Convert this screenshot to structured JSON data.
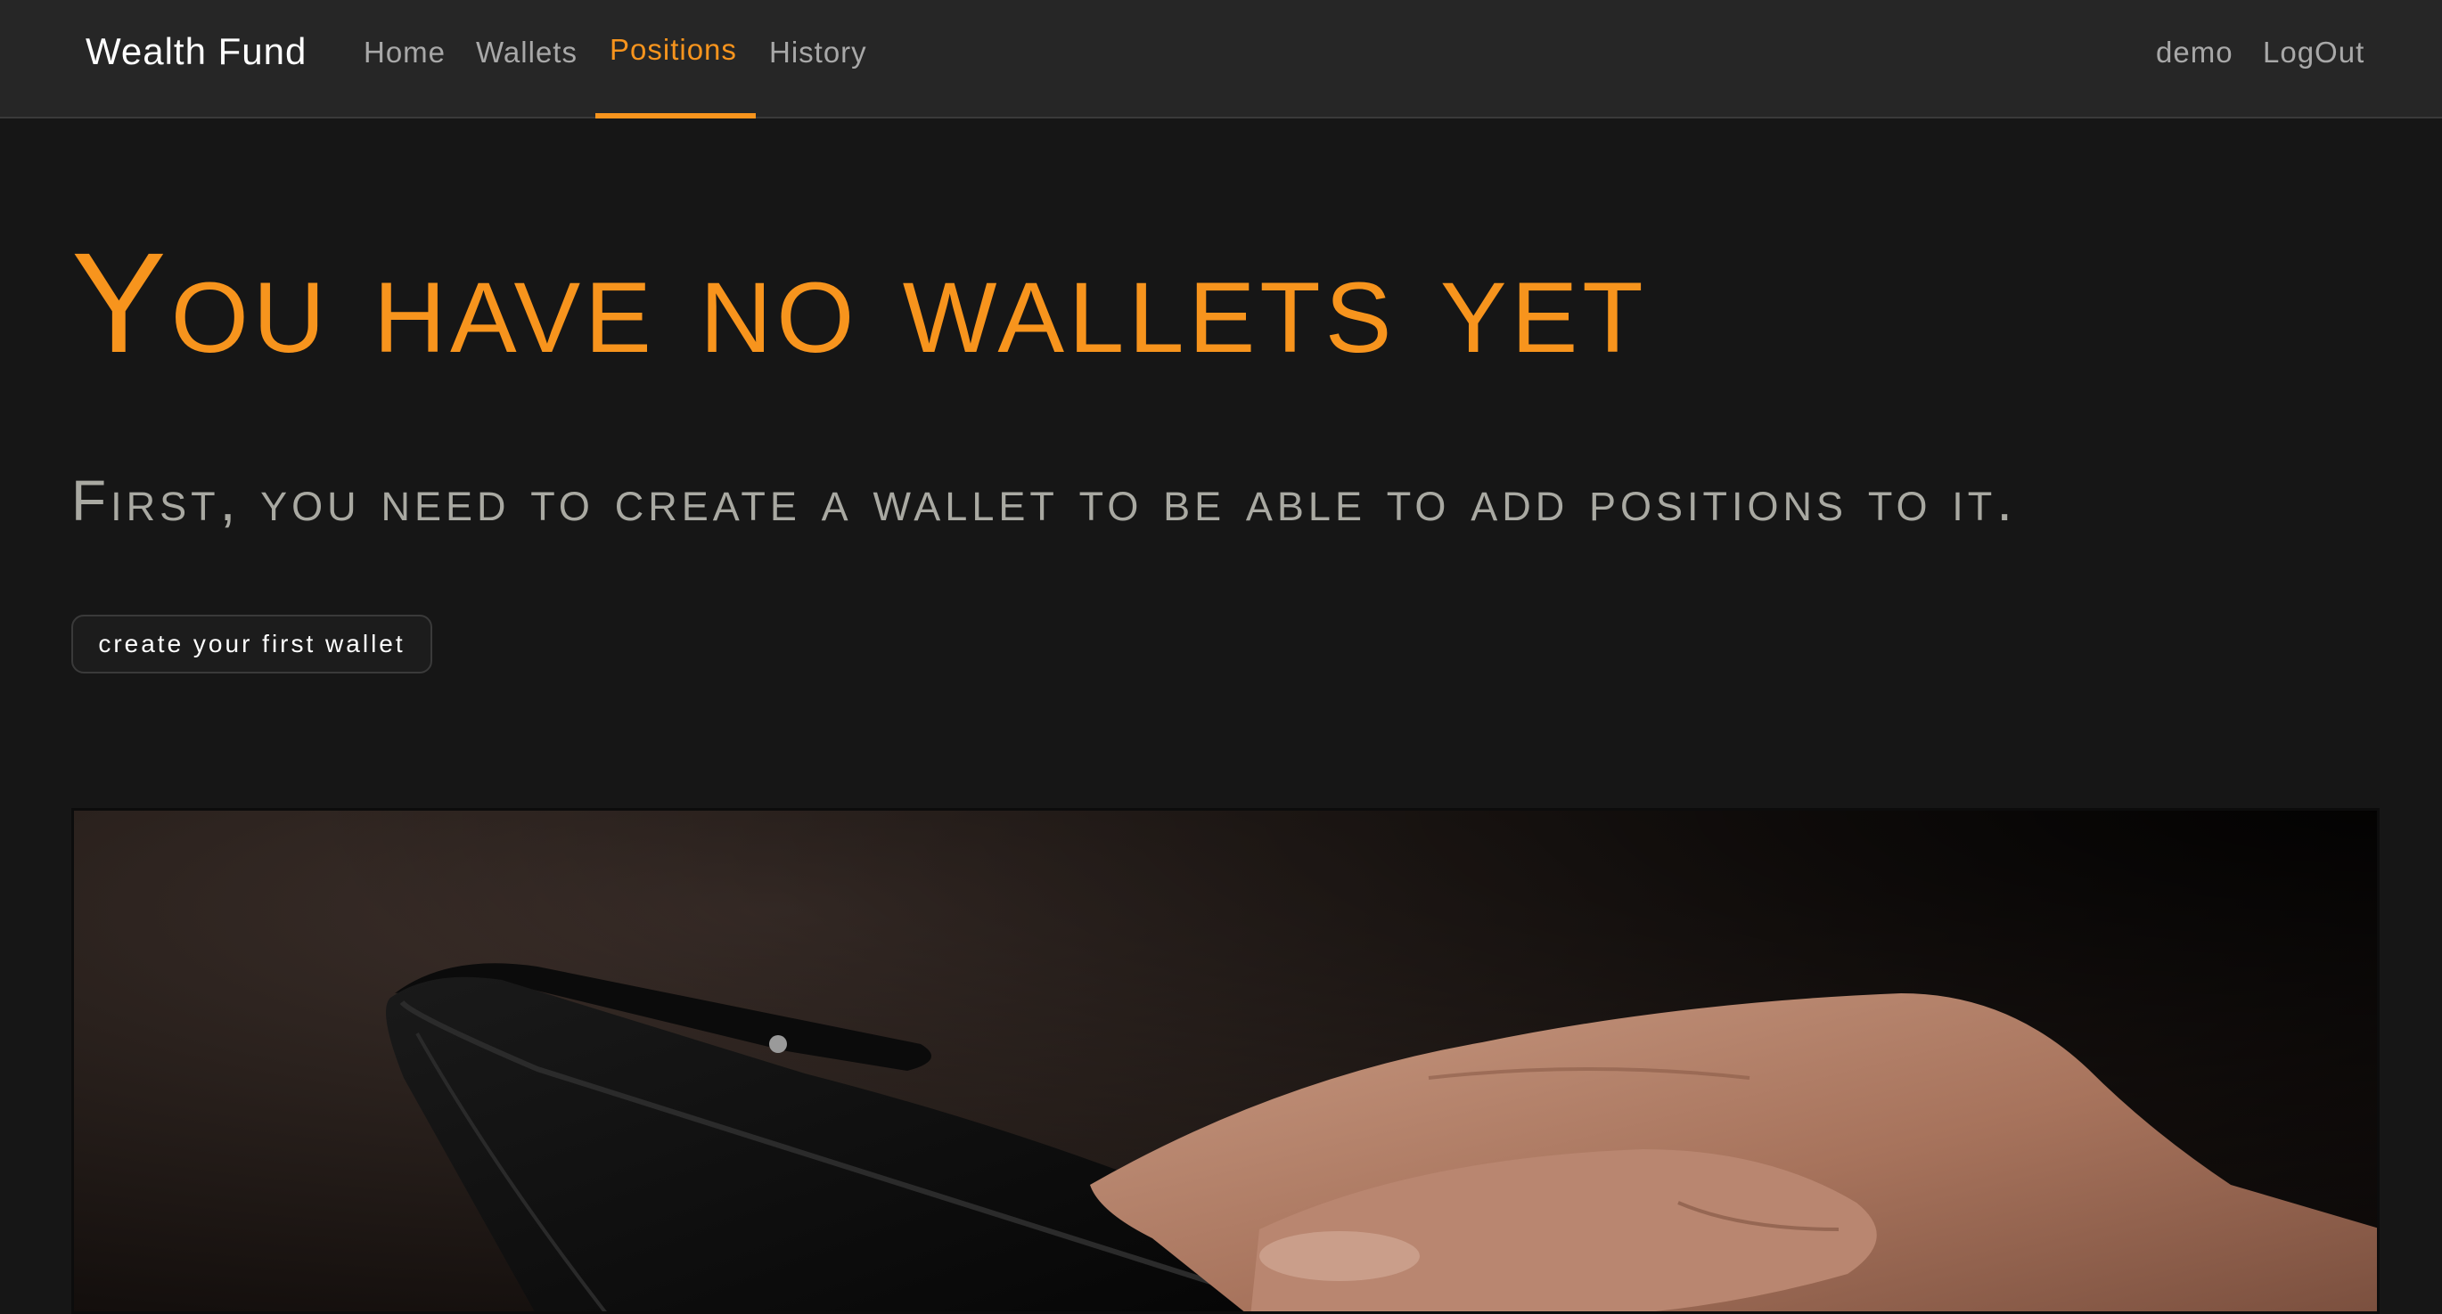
{
  "navbar": {
    "brand": "Wealth Fund",
    "links": [
      "Home",
      "Wallets",
      "Positions",
      "History"
    ],
    "active": "Positions",
    "user": "demo",
    "logout": "LogOut"
  },
  "hero": {
    "title": "You have no wallets yet",
    "subtitle": "First, you need to create a wallet to be able to add positions to it.",
    "button_label": "create your first wallet"
  },
  "colors": {
    "accent": "#f7941d",
    "background": "#161616",
    "navbar": "#262626",
    "muted_text": "#a9a9a2"
  },
  "icons": {
    "hero_image": "empty-wallet-in-hand-photo"
  }
}
